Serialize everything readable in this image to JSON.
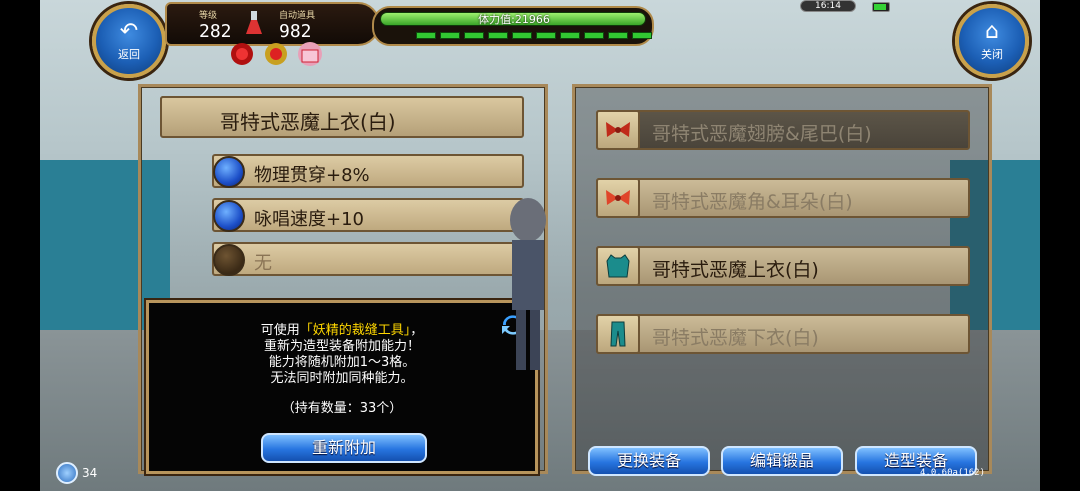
{
  "hud": {
    "back_button": {
      "label": "返回",
      "icon": "undo-arrow-icon"
    },
    "close_button": {
      "label": "关闭",
      "icon": "home-icon"
    },
    "level": {
      "label": "等级",
      "value": "282"
    },
    "auto_items": {
      "label": "自动道具",
      "value": "982"
    },
    "stamina": {
      "text": "体力值:21966",
      "fraction": 1.0
    },
    "clock": "16:14",
    "sp_segments": 10
  },
  "left": {
    "item_name": "哥特式恶魔上衣(白)",
    "abilities": [
      {
        "text": "物理贯穿+8%",
        "filled": true
      },
      {
        "text": "咏唱速度+10",
        "filled": true
      },
      {
        "text": "无",
        "filled": false
      }
    ],
    "info": {
      "line1_pre": "可使用",
      "line1_highlight": "「妖精的裁缝工具」",
      "line1_post": "，",
      "line2": "重新为造型装备附加能力！",
      "line3": "能力将随机附加1～3格。",
      "line4": "无法同时附加同种能力。",
      "owned": "（持有数量：33个）",
      "button": "重新附加"
    }
  },
  "right": {
    "equipment": [
      {
        "name": "哥特式恶魔翅膀&尾巴(白)",
        "icon": "ribbon-icon",
        "state": "dim"
      },
      {
        "name": "哥特式恶魔角&耳朵(白)",
        "icon": "ribbon-icon",
        "state": "grey"
      },
      {
        "name": "哥特式恶魔上衣(白)",
        "icon": "coat-icon",
        "state": "active"
      },
      {
        "name": "哥特式恶魔下衣(白)",
        "icon": "pants-icon",
        "state": "grey"
      }
    ],
    "tabs": [
      "更换装备",
      "编辑锻晶",
      "造型装备"
    ]
  },
  "footer": {
    "count": "34",
    "version": "4.0.60a(162)"
  }
}
